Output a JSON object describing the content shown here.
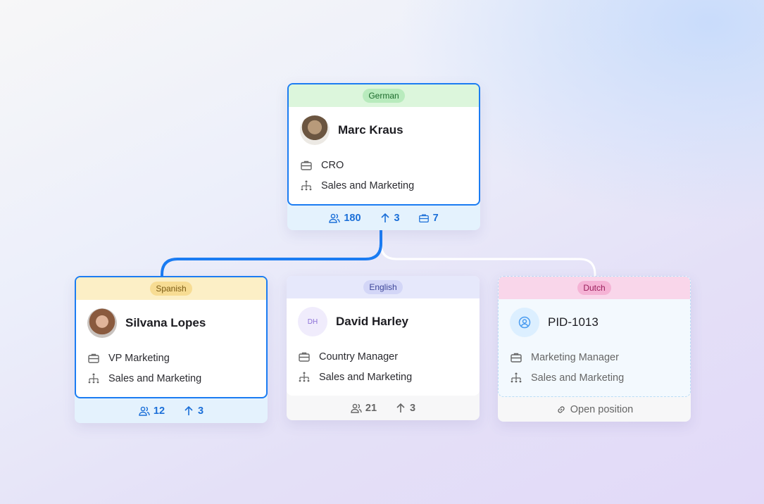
{
  "colors": {
    "accent": "#1b7cf2"
  },
  "root": {
    "language": "German",
    "name": "Marc Kraus",
    "title": "CRO",
    "department": "Sales and Marketing",
    "stats": {
      "people": "180",
      "reports": "3",
      "positions": "7"
    }
  },
  "children": [
    {
      "language": "Spanish",
      "name": "Silvana Lopes",
      "title": "VP Marketing",
      "department": "Sales and Marketing",
      "stats": {
        "people": "12",
        "reports": "3"
      }
    },
    {
      "language": "English",
      "name": "David Harley",
      "initials": "DH",
      "title": "Country Manager",
      "department": "Sales and Marketing",
      "stats": {
        "people": "21",
        "reports": "3"
      }
    },
    {
      "language": "Dutch",
      "name": "PID-1013",
      "title": "Marketing Manager",
      "department": "Sales and Marketing",
      "status": "Open position"
    }
  ]
}
